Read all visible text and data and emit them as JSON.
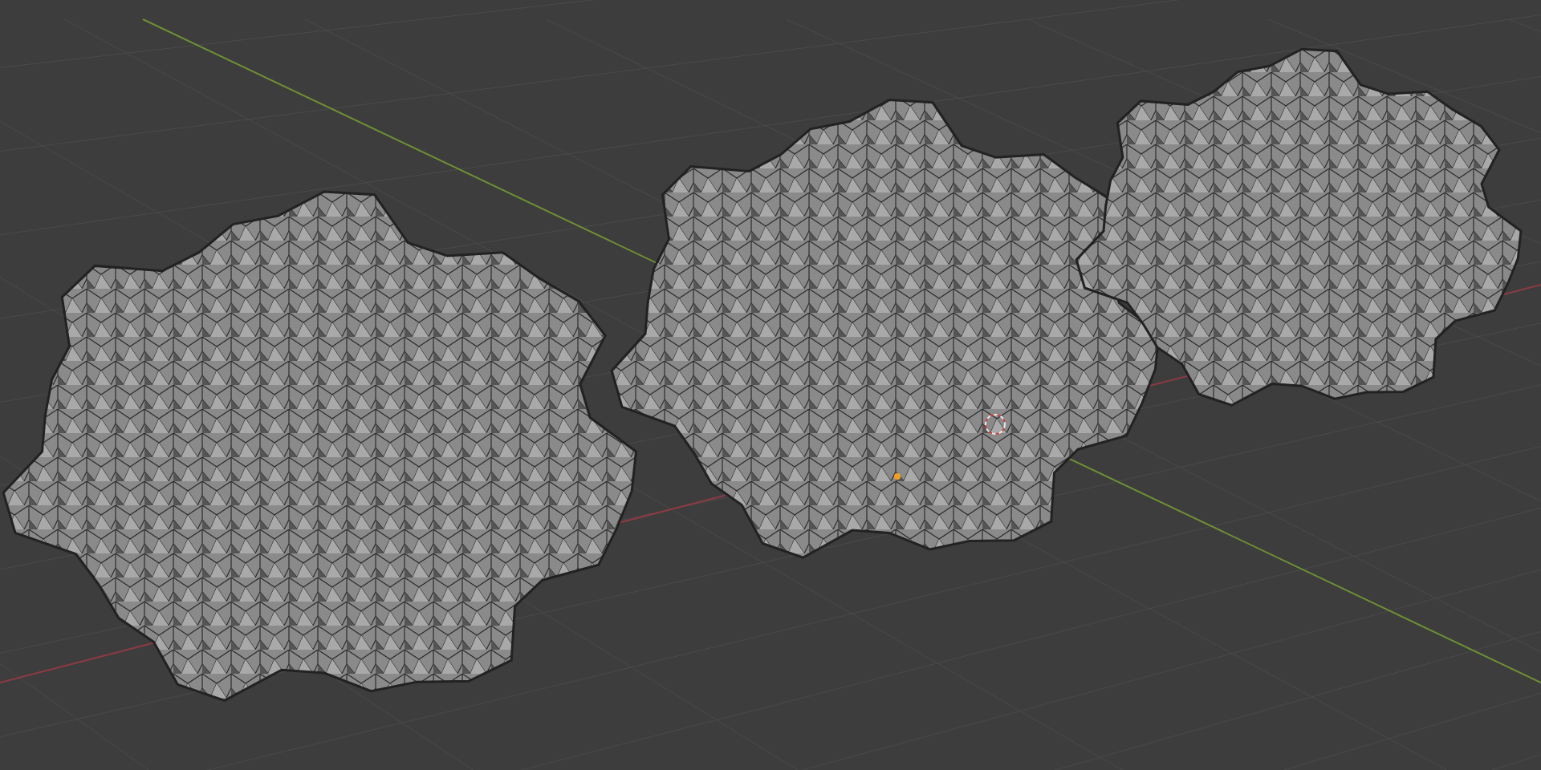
{
  "viewport": {
    "objects": [
      {
        "kind": "bush"
      },
      {
        "kind": "bush"
      },
      {
        "kind": "bush"
      }
    ],
    "cursor": {
      "kind": "crosshair"
    }
  }
}
